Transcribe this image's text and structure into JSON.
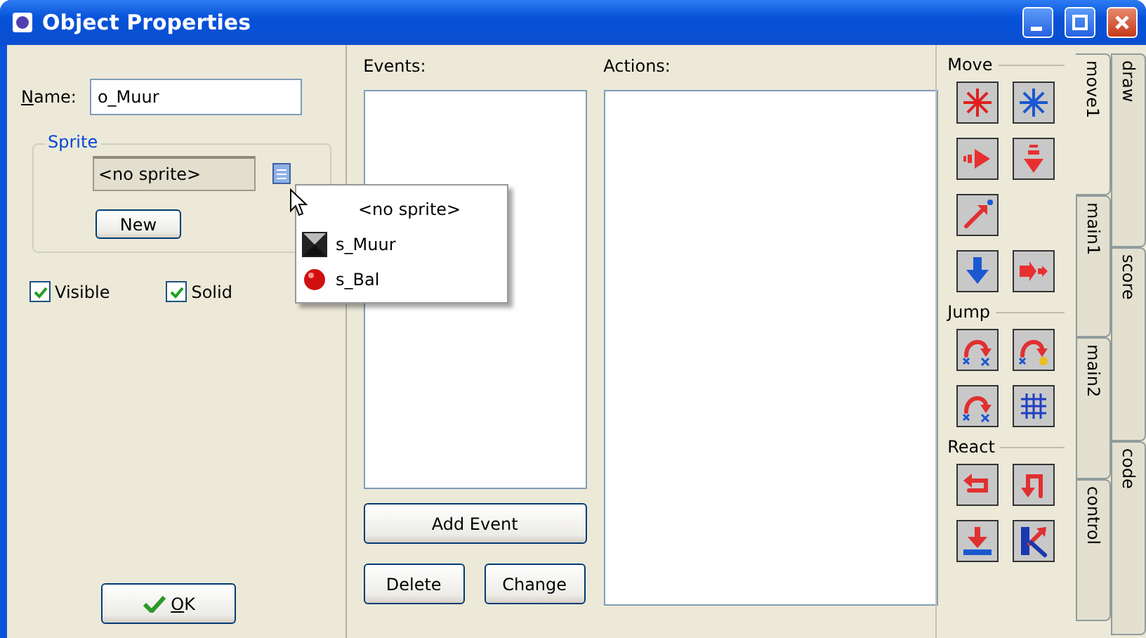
{
  "window": {
    "title": "Object Properties"
  },
  "name_field": {
    "label": "Name:",
    "value": "o_Muur"
  },
  "sprite_group": {
    "label": "Sprite",
    "value": "<no sprite>",
    "new_button": "New"
  },
  "checkboxes": [
    {
      "label": "Visible",
      "checked": true
    },
    {
      "label": "Solid",
      "checked": true
    }
  ],
  "ok_button": "OK",
  "sprite_menu": [
    {
      "label": "<no sprite>",
      "kind": "none"
    },
    {
      "label": "s_Muur",
      "kind": "block"
    },
    {
      "label": "s_Bal",
      "kind": "ball"
    }
  ],
  "events": {
    "label": "Events:",
    "add_button": "Add Event",
    "delete_button": "Delete",
    "change_button": "Change"
  },
  "actions": {
    "label": "Actions:"
  },
  "palette_groups": [
    {
      "label": "Move"
    },
    {
      "label": "Jump"
    },
    {
      "label": "React"
    }
  ],
  "tab_columns": [
    [
      {
        "label": "move1",
        "selected": true
      },
      {
        "label": "main1",
        "selected": false
      },
      {
        "label": "main2",
        "selected": false
      },
      {
        "label": "control",
        "selected": false
      }
    ],
    [
      {
        "label": "draw",
        "selected": false
      },
      {
        "label": "score",
        "selected": false
      },
      {
        "label": "code",
        "selected": false
      }
    ]
  ]
}
